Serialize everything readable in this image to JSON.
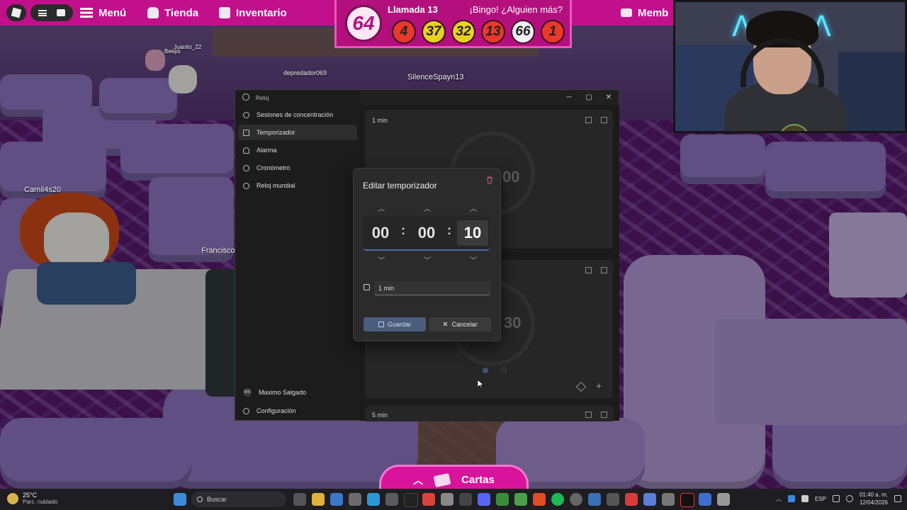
{
  "topbar": {
    "menu_label": "Menú",
    "shop_label": "Tienda",
    "inventory_label": "Inventario",
    "membership_label": "Memb"
  },
  "bingo": {
    "current_number": "64",
    "call_label": "Llamada 13",
    "message": "¡Bingo! ¿Alguien más?",
    "balls": [
      {
        "n": "4",
        "color": "#e8392a"
      },
      {
        "n": "37",
        "color": "#e9d21f"
      },
      {
        "n": "32",
        "color": "#e9d21f"
      },
      {
        "n": "13",
        "color": "#e8392a"
      },
      {
        "n": "66",
        "color": "#f1eef2"
      },
      {
        "n": "1",
        "color": "#e8392a"
      }
    ]
  },
  "players": {
    "p1": "Camil4s20",
    "p2": "depredador069",
    "p3": "SilenceSpayn13",
    "p4": "Juanito_22",
    "p5": "Beeps",
    "p6": "Francisco"
  },
  "clock_app": {
    "title": "Reloj",
    "nav": [
      {
        "label": "Sesiones de concentración",
        "icon": "focus-icon"
      },
      {
        "label": "Temporizador",
        "icon": "hourglass-icon"
      },
      {
        "label": "Alarma",
        "icon": "bell-icon"
      },
      {
        "label": "Cronómetro",
        "icon": "stopwatch-icon"
      },
      {
        "label": "Reloj mundial",
        "icon": "globe-icon"
      }
    ],
    "user_initials": "MS",
    "user_name": "Maximo Salgado",
    "settings_label": "Configuración",
    "timers": [
      {
        "label": "1 min",
        "ghost_time": "00"
      },
      {
        "label": "",
        "ghost_time": "30"
      },
      {
        "label": "5 min"
      }
    ]
  },
  "dialog": {
    "title": "Editar temporizador",
    "hours": "00",
    "minutes": "00",
    "seconds": "10",
    "name_value": "1 min",
    "save_label": "Guardar",
    "cancel_label": "Cancelar"
  },
  "cartas": {
    "label": "Cartas"
  },
  "taskbar": {
    "temperature": "25°C",
    "weather": "Parc. nublado",
    "search_placeholder": "Buscar",
    "language": "ESP",
    "time": "01:40 a. m.",
    "date": "12/04/2026"
  }
}
